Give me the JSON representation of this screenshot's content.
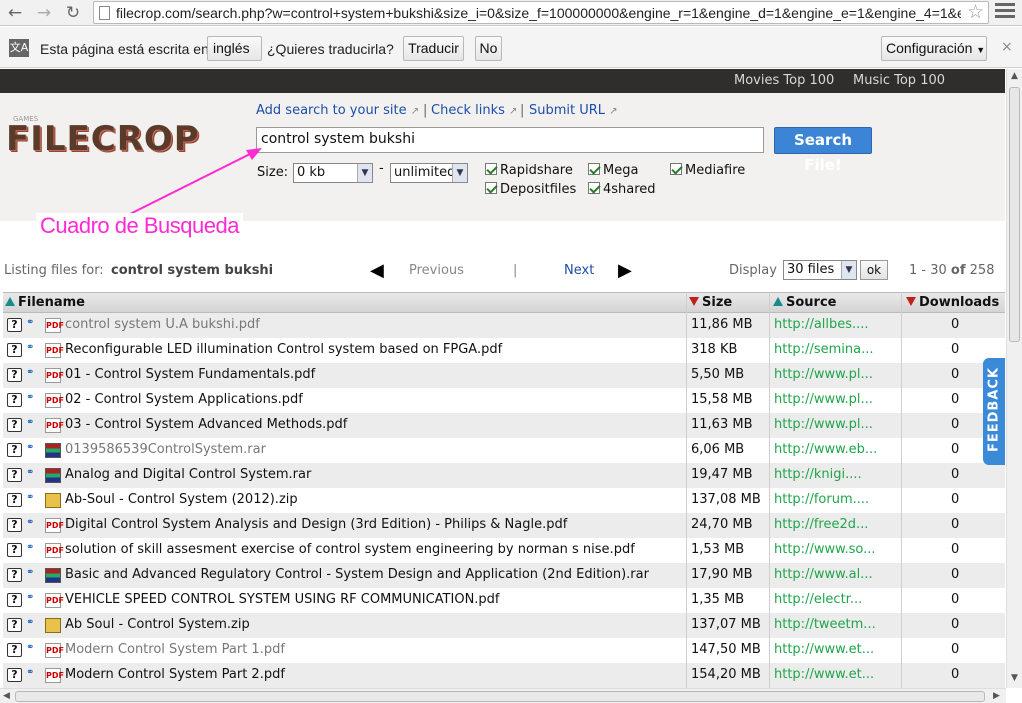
{
  "browser": {
    "url": "filecrop.com/search.php?w=control+system+bukshi&size_i=0&size_f=100000000&engine_r=1&engine_d=1&engine_e=1&engine_4=1&e",
    "back_icon": "back-arrow-icon",
    "forward_icon": "forward-arrow-icon",
    "reload_icon": "reload-icon"
  },
  "translate_bar": {
    "text1": "Esta página está escrita en",
    "language": "inglés",
    "question": "¿Quieres traducirla?",
    "translate_btn": "Traducir",
    "no_btn": "No",
    "settings_btn": "Configuración",
    "close": "×"
  },
  "topbar": {
    "movies": "Movies Top 100",
    "music": "Music Top 100"
  },
  "header": {
    "logo_text": "FILECROP",
    "logo_small": "GAMES",
    "links": {
      "add_search": "Add search to your site",
      "check_links": "Check links",
      "submit_url": "Submit URL",
      "separator": "|"
    },
    "search_value": "control system bukshi",
    "search_button": "Search File!",
    "size_label": "Size:",
    "size_from": "0 kb",
    "size_dash": "-",
    "size_to": "unlimited",
    "engines": [
      "Rapidshare",
      "Mega",
      "Mediafire",
      "Depositfiles",
      "4shared"
    ]
  },
  "annotation": "Cuadro de Busqueda",
  "listing": {
    "label": "Listing files for:",
    "query": "control system bukshi",
    "previous": "Previous",
    "separator": "|",
    "next": "Next",
    "display_label": "Display",
    "display_value": "30 files",
    "ok": "ok",
    "range_a": "1 - 30",
    "range_of": "of",
    "range_total": "258"
  },
  "table": {
    "headers": {
      "filename": "Filename",
      "size": "Size",
      "source": "Source",
      "downloads": "Downloads"
    },
    "rows": [
      {
        "name": "control system U.A bukshi.pdf",
        "type": "pdf",
        "visited": true,
        "size": "11,86 MB",
        "source": "http://allbes....",
        "downloads": "0"
      },
      {
        "name": "Reconfigurable LED illumination Control system based on FPGA.pdf",
        "type": "pdf",
        "visited": false,
        "size": "318 KB",
        "source": "http://semina...",
        "downloads": "0"
      },
      {
        "name": "01 - Control System Fundamentals.pdf",
        "type": "pdf",
        "visited": false,
        "size": "5,50 MB",
        "source": "http://www.pl...",
        "downloads": "0"
      },
      {
        "name": "02 - Control System Applications.pdf",
        "type": "pdf",
        "visited": false,
        "size": "15,58 MB",
        "source": "http://www.pl...",
        "downloads": "0"
      },
      {
        "name": "03 - Control System Advanced Methods.pdf",
        "type": "pdf",
        "visited": false,
        "size": "11,63 MB",
        "source": "http://www.pl...",
        "downloads": "0"
      },
      {
        "name": "0139586539ControlSystem.rar",
        "type": "rar",
        "visited": true,
        "size": "6,06 MB",
        "source": "http://www.eb...",
        "downloads": "0"
      },
      {
        "name": "Analog and Digital Control System.rar",
        "type": "rar",
        "visited": false,
        "size": "19,47 MB",
        "source": "http://knigi....",
        "downloads": "0"
      },
      {
        "name": "Ab-Soul - Control System (2012).zip",
        "type": "zip",
        "visited": false,
        "size": "137,08 MB",
        "source": "http://forum....",
        "downloads": "0"
      },
      {
        "name": "Digital Control System Analysis and Design (3rd Edition) - Philips & Nagle.pdf",
        "type": "pdf",
        "visited": false,
        "size": "24,70 MB",
        "source": "http://free2d...",
        "downloads": "0"
      },
      {
        "name": "solution of skill assesment exercise of control system engineering by norman s nise.pdf",
        "type": "pdf",
        "visited": false,
        "size": "1,53 MB",
        "source": "http://www.so...",
        "downloads": "0"
      },
      {
        "name": "Basic and Advanced Regulatory Control - System Design and Application (2nd Edition).rar",
        "type": "rar",
        "visited": false,
        "size": "17,90 MB",
        "source": "http://www.al...",
        "downloads": "0"
      },
      {
        "name": "VEHICLE SPEED CONTROL SYSTEM USING RF COMMUNICATION.pdf",
        "type": "pdf",
        "visited": false,
        "size": "1,35 MB",
        "source": "http://electr...",
        "downloads": "0"
      },
      {
        "name": "Ab Soul - Control System.zip",
        "type": "zip",
        "visited": false,
        "size": "137,07 MB",
        "source": "http://tweetm...",
        "downloads": "0"
      },
      {
        "name": "Modern Control System Part 1.pdf",
        "type": "pdf",
        "visited": true,
        "size": "147,50 MB",
        "source": "http://www.et...",
        "downloads": "0"
      },
      {
        "name": "Modern Control System Part 2.pdf",
        "type": "pdf",
        "visited": false,
        "size": "154,20 MB",
        "source": "http://www.et...",
        "downloads": "0"
      }
    ]
  },
  "feedback": "FEEDBACK",
  "colors": {
    "search_button": "#3b84d6",
    "source_link": "#20a64a",
    "annotation": "#ff2ad4",
    "topbar": "#302e2d"
  }
}
